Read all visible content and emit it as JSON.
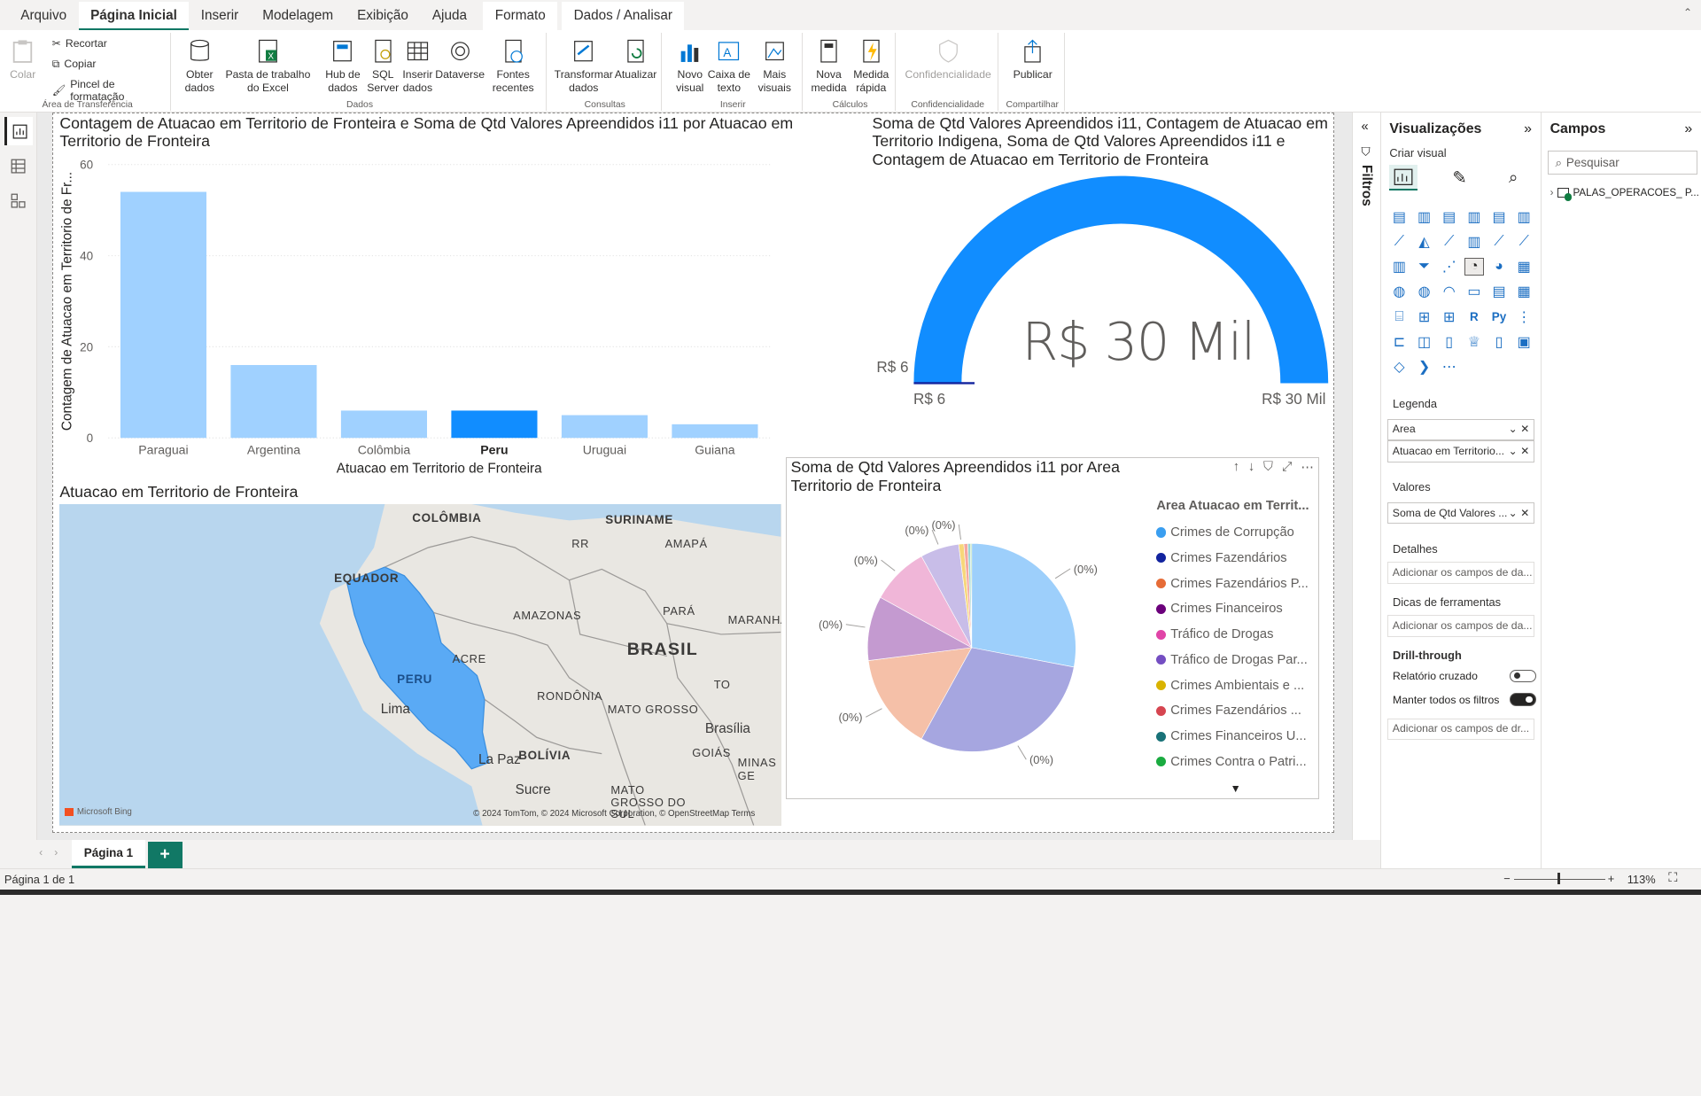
{
  "ribbon_tabs": [
    "Arquivo",
    "Página Inicial",
    "Inserir",
    "Modelagem",
    "Exibição",
    "Ajuda",
    "Formato",
    "Dados / Analisar"
  ],
  "ribbon": {
    "clipboard": {
      "paste": "Colar",
      "cut": "Recortar",
      "copy": "Copiar",
      "format_painter": "Pincel de formatação",
      "group": "Área de Transferência"
    },
    "data": {
      "get_data": "Obter dados",
      "excel": "Pasta de trabalho do Excel",
      "hub": "Hub de dados",
      "sql": "SQL Server",
      "enter": "Inserir dados",
      "dataverse": "Dataverse",
      "recent": "Fontes recentes",
      "group": "Dados"
    },
    "queries": {
      "transform": "Transformar dados",
      "refresh": "Atualizar",
      "group": "Consultas"
    },
    "insert": {
      "new_visual": "Novo visual",
      "text_box": "Caixa de texto",
      "more_visuals": "Mais visuais",
      "group": "Inserir"
    },
    "calcs": {
      "new_measure": "Nova medida",
      "quick_measure": "Medida rápida",
      "group": "Cálculos"
    },
    "sensitivity": {
      "label": "Confidencialidade",
      "group": "Confidencialidade"
    },
    "share": {
      "publish": "Publicar",
      "group": "Compartilhar"
    }
  },
  "visuals": {
    "bar_title": "Contagem de Atuacao em Territorio de Fronteira e Soma de Qtd Valores Apreendidos i11 por Atuacao em Territorio de Fronteira",
    "gauge_title": "Soma de Qtd Valores Apreendidos i11, Contagem de Atuacao em Territorio Indigena, Soma de Qtd Valores Apreendidos i11 e Contagem de Atuacao em Territorio de Fronteira",
    "map_title": "Atuacao em Territorio de Fronteira",
    "pie_title": "Soma de Qtd Valores Apreendidos i11 por Area Territorio de Fronteira",
    "gauge": {
      "value": "R$ 30 Mil",
      "min": "R$ 6",
      "max": "R$ 30 Mil",
      "target": "R$ 6",
      "value_fraction": 1.0
    }
  },
  "chart_data": [
    {
      "type": "bar",
      "categories": [
        "Paraguai",
        "Argentina",
        "Colômbia",
        "Peru",
        "Uruguai",
        "Guiana"
      ],
      "values": [
        54,
        16,
        6,
        6,
        5,
        3
      ],
      "highlighted": "Peru",
      "xlabel": "Atuacao em Territorio de Fronteira",
      "ylabel": "Contagem de Atuacao em Territorio de Fr...",
      "yticks": [
        0,
        20,
        40,
        60
      ],
      "ylim": [
        0,
        60
      ],
      "grid": true
    },
    {
      "type": "pie",
      "legend_title": "Area Atuacao em Territ...",
      "slices": [
        {
          "name": "Crimes de Corrupção",
          "value": 28,
          "label": "(0%)"
        },
        {
          "name": "Crimes Fazendários",
          "value": 30,
          "label": "(0%)"
        },
        {
          "name": "Crimes Fazendários P...",
          "value": 15,
          "label": "(0%)"
        },
        {
          "name": "Crimes Financeiros",
          "value": 10,
          "label": "(0%)"
        },
        {
          "name": "Tráfico de Drogas",
          "value": 9,
          "label": "(0%)"
        },
        {
          "name": "Tráfico de Drogas Par...",
          "value": 6,
          "label": "(0%)"
        },
        {
          "name": "Crimes Ambientais e ...",
          "value": 0.8,
          "label": "(0%)"
        },
        {
          "name": "Crimes Fazendários ...",
          "value": 0.6,
          "label": ""
        },
        {
          "name": "Crimes Financeiros U...",
          "value": 0.4,
          "label": ""
        },
        {
          "name": "Crimes Contra o Patri...",
          "value": 0.2,
          "label": ""
        }
      ]
    }
  ],
  "pie_colors": [
    "#9dcffb",
    "#a6a6e0",
    "#f5c0a8",
    "#c49ad0",
    "#f0b6d8",
    "#c8bde8",
    "#f7d77a",
    "#f4a8a0",
    "#9ad6d0",
    "#a9d9a9"
  ],
  "legend_colors": [
    "#3a9ef0",
    "#12239e",
    "#e66c37",
    "#6b007b",
    "#e044a7",
    "#744ec2",
    "#d9b300",
    "#d64550",
    "#197278",
    "#1aab40"
  ],
  "map": {
    "labels": [
      "COLÔMBIA",
      "SURINAME",
      "EQUADOR",
      "RR",
      "AMAPÁ",
      "AMAZONAS",
      "PARÁ",
      "MARANHÃ",
      "ACRE",
      "PERU",
      "BRASIL",
      "Lima",
      "RONDÔNIA",
      "TO",
      "MATO GROSSO",
      "Brasília",
      "GOIÁS",
      "BOLÍVIA",
      "La Paz",
      "MINAS GE",
      "Sucre",
      "MATO GROSSO DO SUL"
    ],
    "copyright": "© 2024 TomTom, © 2024 Microsoft Corporation, © OpenStreetMap Terms",
    "attribution": "Microsoft Bing"
  },
  "filters_label": "Filtros",
  "viz_pane": {
    "title": "Visualizações",
    "build": "Criar visual",
    "legend": "Legenda",
    "legend_fields": [
      "Area",
      "Atuacao em Territorio..."
    ],
    "values": "Valores",
    "value_field": "Soma de Qtd Valores ...",
    "details": "Detalhes",
    "details_placeholder": "Adicionar os campos de da...",
    "tooltips": "Dicas de ferramentas",
    "tooltips_placeholder": "Adicionar os campos de da...",
    "drill": "Drill-through",
    "cross_report": "Relatório cruzado",
    "keep_filters": "Manter todos os filtros",
    "drill_placeholder": "Adicionar os campos de dr..."
  },
  "fields_pane": {
    "title": "Campos",
    "search_placeholder": "Pesquisar",
    "table": "PALAS_OPERACOES_ P..."
  },
  "pages": {
    "current": "Página 1",
    "add": "+"
  },
  "status": {
    "page_info": "Página 1 de 1",
    "zoom": "113%"
  }
}
